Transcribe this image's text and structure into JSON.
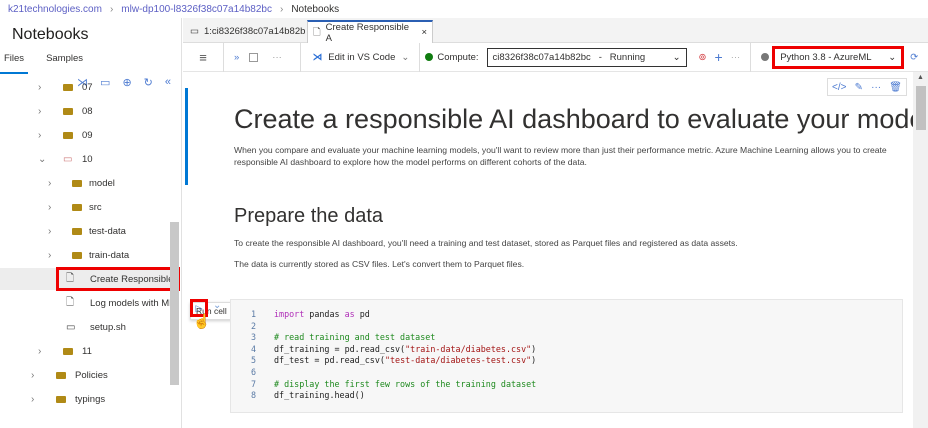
{
  "breadcrumb": [
    "k21technologies.com",
    "mlw-dp100-l8326f38c07a14b82bc",
    "Notebooks"
  ],
  "sidebar": {
    "title": "Notebooks",
    "tabs": [
      "Files",
      "Samples"
    ],
    "tree": [
      {
        "label": "07",
        "level": 1,
        "type": "folder"
      },
      {
        "label": "08",
        "level": 1,
        "type": "folder"
      },
      {
        "label": "09",
        "level": 1,
        "type": "folder"
      },
      {
        "label": "10",
        "level": 1,
        "type": "folder-open"
      },
      {
        "label": "model",
        "level": 2,
        "type": "folder"
      },
      {
        "label": "src",
        "level": 2,
        "type": "folder"
      },
      {
        "label": "test-data",
        "level": 2,
        "type": "folder"
      },
      {
        "label": "train-data",
        "level": 2,
        "type": "folder"
      },
      {
        "label": "Create Responsible",
        "level": 3,
        "type": "notebook",
        "selected": true
      },
      {
        "label": "Log models with Ml",
        "level": 3,
        "type": "notebook"
      },
      {
        "label": "setup.sh",
        "level": 3,
        "type": "terminal"
      },
      {
        "label": "11",
        "level": 1,
        "type": "folder"
      },
      {
        "label": "Policies",
        "level": 0,
        "type": "folder"
      },
      {
        "label": "typings",
        "level": 0,
        "type": "folder"
      }
    ]
  },
  "tabs": [
    {
      "label": "1:ci8326f38c07a14b82b"
    },
    {
      "label": "Create Responsible A",
      "active": true
    }
  ],
  "toolbar": {
    "edit_vscode": "Edit in VS Code",
    "compute_label": "Compute:",
    "compute_value": "ci8326f38c07a14b82bc   -   Running",
    "kernel": "Python 3.8 - AzureML"
  },
  "notebook": {
    "title": "Create a responsible AI dashboard to evaluate your models",
    "intro": "When you compare and evaluate your machine learning models, you'll want to review more than just their performance metric. Azure Machine Learning allows you to create responsible AI dashboard to explore how the model performs on different cohorts of the data.",
    "h2": "Prepare the data",
    "p1": "To create the responsible AI dashboard, you'll need a training and test dataset, stored as Parquet files and registered as data assets.",
    "p2": "The data is currently stored as CSV files. Let's convert them to Parquet files.",
    "tooltip": "Run cell",
    "code": [
      {
        "n": "1",
        "t": "import pandas as pd"
      },
      {
        "n": "2",
        "t": ""
      },
      {
        "n": "3",
        "t": "# read training and test dataset"
      },
      {
        "n": "4",
        "t": "df_training = pd.read_csv(\"train-data/diabetes.csv\")"
      },
      {
        "n": "5",
        "t": "df_test = pd.read_csv(\"test-data/diabetes-test.csv\")"
      },
      {
        "n": "6",
        "t": ""
      },
      {
        "n": "7",
        "t": "# display the first few rows of the training dataset"
      },
      {
        "n": "8",
        "t": "df_training.head()"
      }
    ]
  },
  "colors": {
    "accent": "#0078d4",
    "highlight": "#e00000",
    "folder": "#b08a16",
    "running": "#107c10"
  }
}
